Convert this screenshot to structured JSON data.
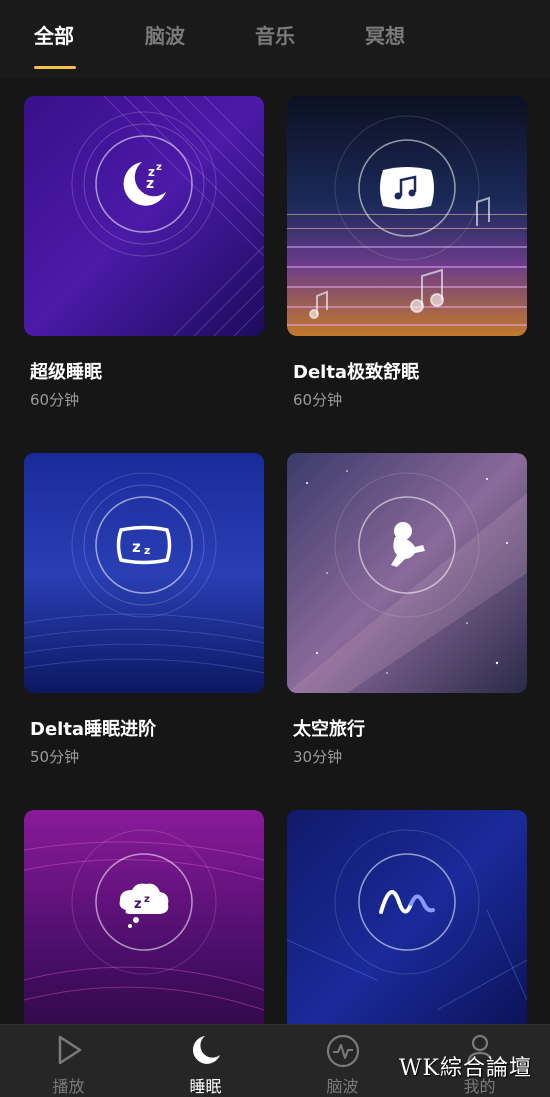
{
  "tabs": [
    {
      "label": "全部"
    },
    {
      "label": "脑波"
    },
    {
      "label": "音乐"
    },
    {
      "label": "冥想"
    }
  ],
  "cards": [
    {
      "title": "超级睡眠",
      "duration": "60分钟",
      "icon": "moon-zzz-icon"
    },
    {
      "title": "Delta极致舒眠",
      "duration": "60分钟",
      "icon": "music-pillow-icon"
    },
    {
      "title": "Delta睡眠进阶",
      "duration": "50分钟",
      "icon": "pillow-zz-icon"
    },
    {
      "title": "太空旅行",
      "duration": "30分钟",
      "icon": "astronaut-icon"
    },
    {
      "title": "",
      "duration": "",
      "icon": "thought-cloud-zz-icon"
    },
    {
      "title": "",
      "duration": "",
      "icon": "wave-signal-icon"
    }
  ],
  "bottom_nav": [
    {
      "label": "播放",
      "icon": "play-icon"
    },
    {
      "label": "睡眠",
      "icon": "moon-icon"
    },
    {
      "label": "脑波",
      "icon": "brainwave-icon"
    },
    {
      "label": "我的",
      "icon": "person-icon"
    }
  ],
  "watermark": "WK綜合論壇",
  "colors": {
    "accent": "#f3c14a",
    "background": "#161616"
  }
}
